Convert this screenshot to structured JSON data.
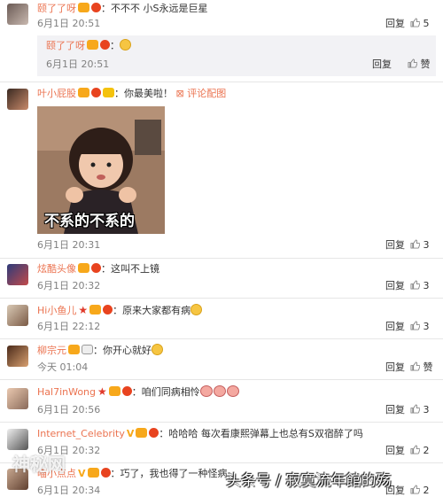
{
  "comments": [
    {
      "user": "颐了了呀",
      "text": "：不不不 小S永远是巨星",
      "time": "6月1日 20:51",
      "reply": "回复",
      "likes": "5"
    },
    {
      "user": "颐了了呀",
      "text": "：",
      "time": "6月1日 20:51",
      "reply": "回复",
      "like_label": "赞"
    },
    {
      "user": "叶小屁股",
      "text": "：你最美啦！",
      "link": "评论配图",
      "time": "6月1日 20:31",
      "reply": "回复",
      "likes": "3",
      "image_caption": "不系的不系的"
    },
    {
      "user": "炫酷头像",
      "text": "：这叫不上镜",
      "time": "6月1日 20:32",
      "reply": "回复",
      "likes": "3"
    },
    {
      "user": "Hi小鱼儿",
      "text": "：原来大家都有病",
      "time": "6月1日 22:12",
      "reply": "回复",
      "likes": "3"
    },
    {
      "user": "柳宗元",
      "text": "：你开心就好",
      "time": "今天 01:04",
      "reply": "回复",
      "like_label": "赞"
    },
    {
      "user": "Hal7inWong",
      "text": "：咱们同病相怜",
      "time": "6月1日 20:56",
      "reply": "回复",
      "likes": "3"
    },
    {
      "user": "Internet_Celebrity",
      "text": "：哈哈哈  每次看康熙弹幕上也总有S双宿醉了吗",
      "time": "6月1日 20:32",
      "reply": "回复",
      "likes": "2"
    },
    {
      "user": "喵小点点",
      "text": "：巧了，我也得了一种怪病...",
      "time": "6月1日 20:34",
      "reply": "回复",
      "likes": "2"
    }
  ],
  "watermark_left": "神秘网",
  "watermark_right": "头条号 / 寂寞流年館的殇"
}
